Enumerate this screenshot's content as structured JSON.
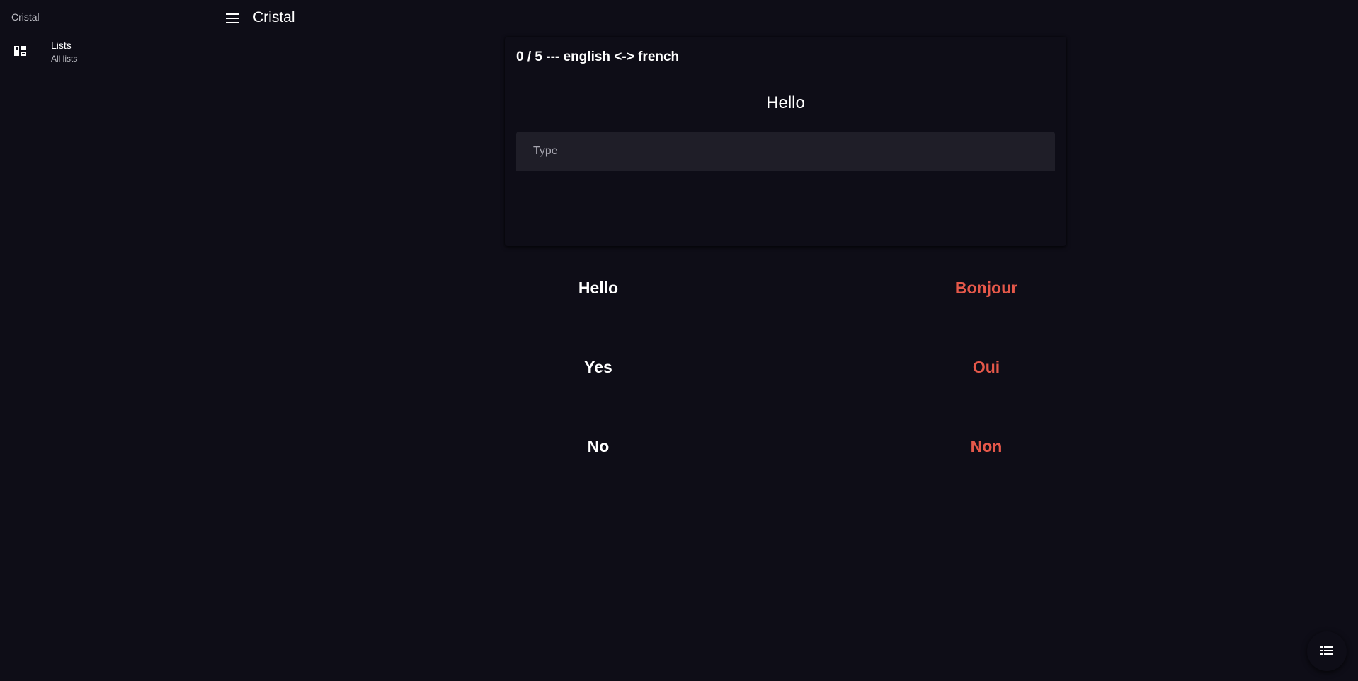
{
  "sidebar": {
    "title": "Cristal",
    "items": [
      {
        "label": "Lists",
        "sublabel": "All lists",
        "icon": "dashboard-icon"
      }
    ]
  },
  "header": {
    "title": "Cristal",
    "menu_icon": "menu-icon"
  },
  "quiz": {
    "progress": "0 / 5 --- english <-> french",
    "prompt": "Hello",
    "answer_placeholder": "Type",
    "answer_value": ""
  },
  "words": [
    {
      "english": "Hello",
      "french": "Bonjour"
    },
    {
      "english": "Yes",
      "french": "Oui"
    },
    {
      "english": "No",
      "french": "Non"
    }
  ],
  "fab": {
    "icon": "list-icon"
  },
  "colors": {
    "background": "#0e0d17",
    "field": "#1f1e28",
    "accent": "#e5584a",
    "text": "#ffffff",
    "muted": "#bdbdc4"
  }
}
